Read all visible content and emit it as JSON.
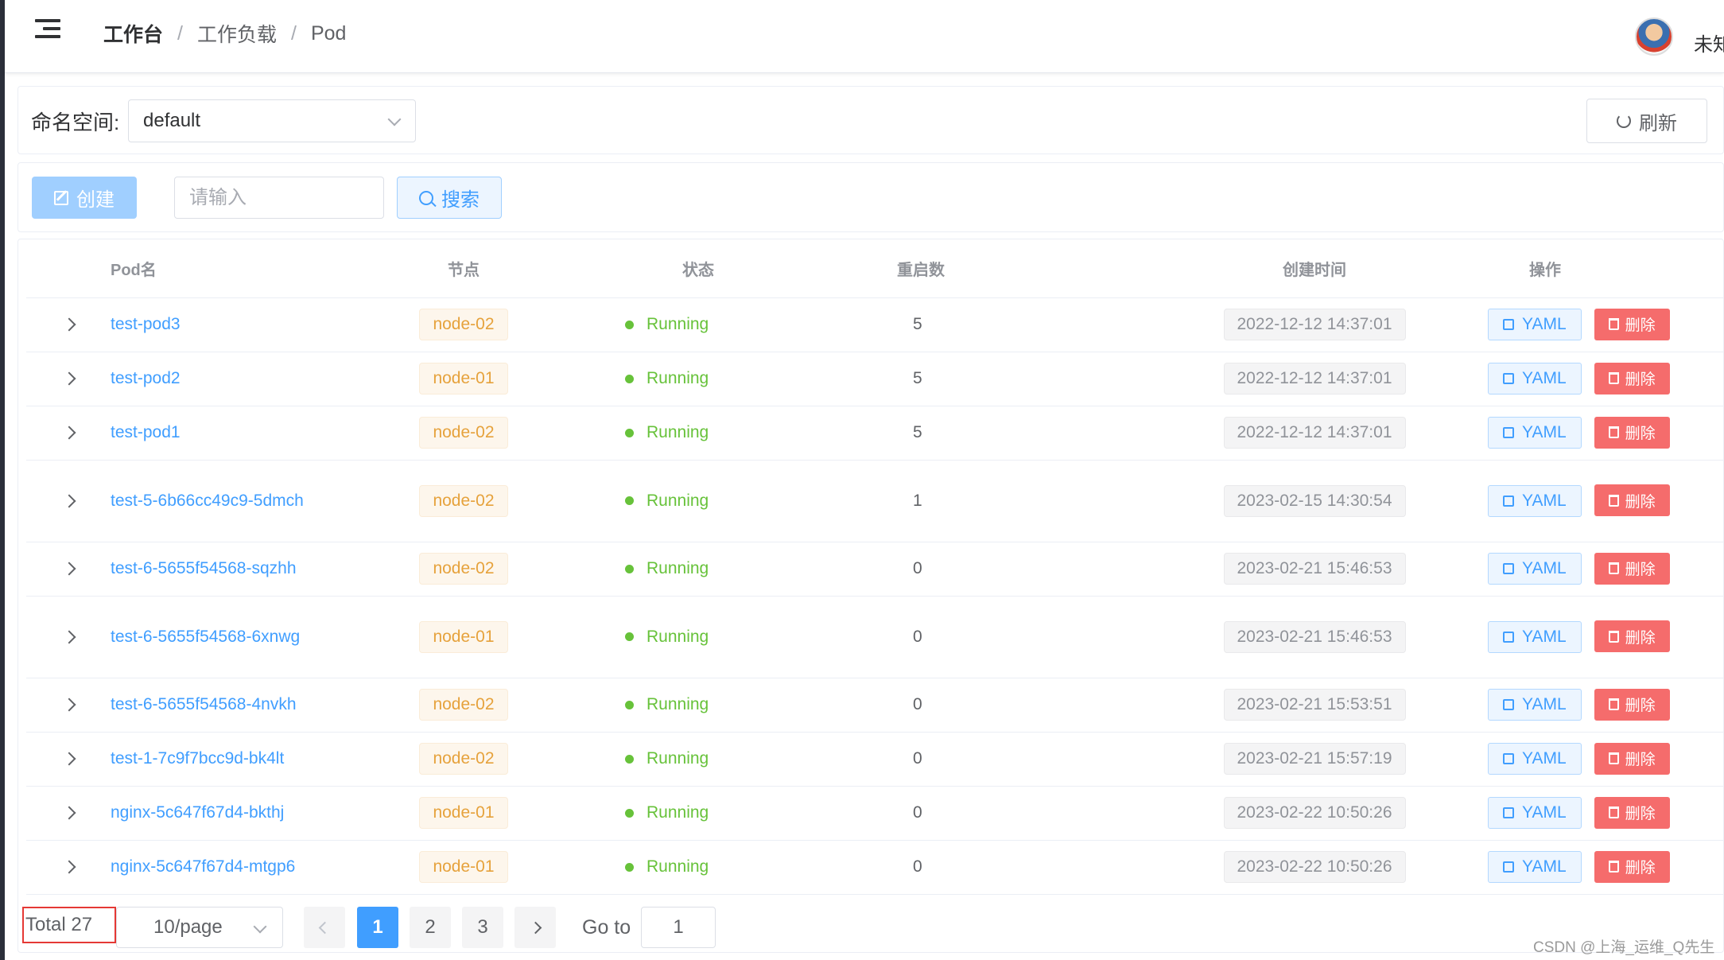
{
  "header": {
    "breadcrumb": [
      "工作台",
      "工作负载",
      "Pod"
    ],
    "separator": "/",
    "username": "未知"
  },
  "namespace": {
    "label": "命名空间:",
    "selected": "default"
  },
  "refresh_label": "刷新",
  "toolbar": {
    "create_label": "创建",
    "search_placeholder": "请输入",
    "search_label": "搜索"
  },
  "table": {
    "columns": [
      "Pod名",
      "节点",
      "状态",
      "重启数",
      "创建时间",
      "操作"
    ],
    "yaml_label": "YAML",
    "delete_label": "删除",
    "rows": [
      {
        "name": "test-pod3",
        "node": "node-02",
        "status": "Running",
        "restarts": "5",
        "created": "2022-12-12 14:37:01"
      },
      {
        "name": "test-pod2",
        "node": "node-01",
        "status": "Running",
        "restarts": "5",
        "created": "2022-12-12 14:37:01"
      },
      {
        "name": "test-pod1",
        "node": "node-02",
        "status": "Running",
        "restarts": "5",
        "created": "2022-12-12 14:37:01"
      },
      {
        "name": "test-5-6b66cc49c9-5dmch",
        "node": "node-02",
        "status": "Running",
        "restarts": "1",
        "created": "2023-02-15 14:30:54"
      },
      {
        "name": "test-6-5655f54568-sqzhh",
        "node": "node-02",
        "status": "Running",
        "restarts": "0",
        "created": "2023-02-21 15:46:53"
      },
      {
        "name": "test-6-5655f54568-6xnwg",
        "node": "node-01",
        "status": "Running",
        "restarts": "0",
        "created": "2023-02-21 15:46:53"
      },
      {
        "name": "test-6-5655f54568-4nvkh",
        "node": "node-02",
        "status": "Running",
        "restarts": "0",
        "created": "2023-02-21 15:53:51"
      },
      {
        "name": "test-1-7c9f7bcc9d-bk4lt",
        "node": "node-02",
        "status": "Running",
        "restarts": "0",
        "created": "2023-02-21 15:57:19"
      },
      {
        "name": "nginx-5c647f67d4-bkthj",
        "node": "node-01",
        "status": "Running",
        "restarts": "0",
        "created": "2023-02-22 10:50:26"
      },
      {
        "name": "nginx-5c647f67d4-mtgp6",
        "node": "node-01",
        "status": "Running",
        "restarts": "0",
        "created": "2023-02-22 10:50:26"
      }
    ]
  },
  "pagination": {
    "total": "Total 27",
    "page_size": "10/page",
    "pages": [
      "1",
      "2",
      "3"
    ],
    "current_page": "1",
    "goto_label": "Go to",
    "goto_value": "1"
  },
  "watermark": "CSDN @上海_运维_Q先生",
  "colors": {
    "primary": "#409eff",
    "success": "#67c23a",
    "warning": "#e6a23c",
    "danger": "#f56c6c"
  }
}
